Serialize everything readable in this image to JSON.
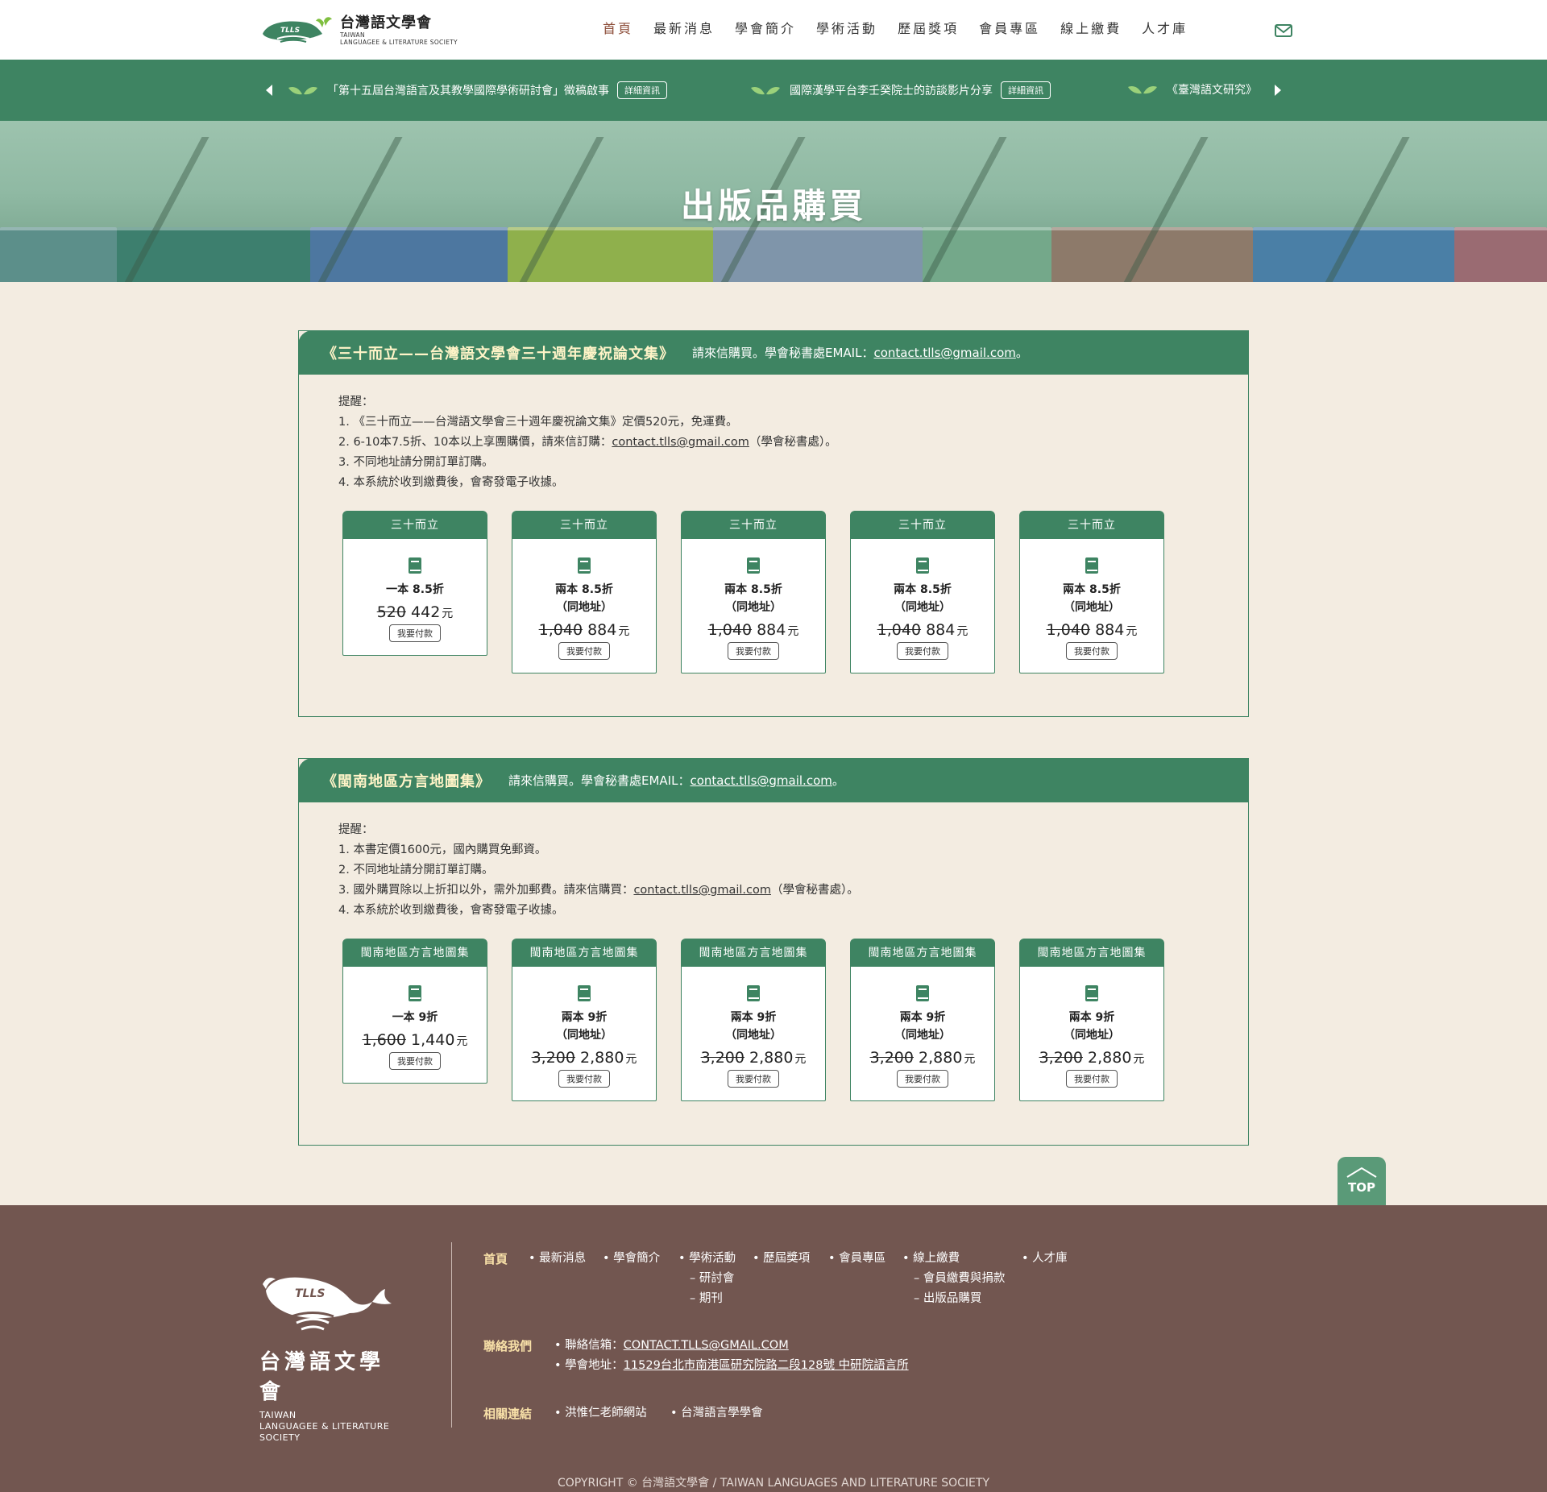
{
  "header": {
    "logo_zh": "台灣語文學會",
    "logo_en_1": "TAIWAN",
    "logo_en_2": "LANGUAGEE & LITERATURE SOCIETY",
    "logo_badge": "TLLS",
    "nav": [
      "首頁",
      "最新消息",
      "學會簡介",
      "學術活動",
      "歷屆獎項",
      "會員專區",
      "線上繳費",
      "人才庫"
    ],
    "active_nav": "首頁"
  },
  "ticker": {
    "items": [
      {
        "text": "「第十五屆台灣語言及其教學國際學術研討會」徵稿啟事",
        "button": "詳細資訊"
      },
      {
        "text": "國際漢學平台李壬癸院士的訪談影片分享",
        "button": "詳細資訊"
      },
      {
        "text": "《臺灣語文研究》"
      }
    ]
  },
  "hero": {
    "title": "出版品購買"
  },
  "sections": [
    {
      "title": "《三十而立——台灣語文學會三十週年慶祝論文集》",
      "note_prefix": "請來信購買。學會秘書處EMAIL：",
      "email": "contact.tlls@gmail.com",
      "note_suffix": "。",
      "notes": {
        "heading": "提醒：",
        "n1": "1. 《三十而立——台灣語文學會三十週年慶祝論文集》定價520元，免運費。",
        "n2_prefix": "2. 6-10本7.5折、10本以上享團購價，請來信訂購：",
        "n2_email": "contact.tlls@gmail.com",
        "n2_suffix": "（學會秘書處）。",
        "n3": "3. 不同地址請分開訂單訂購。",
        "n4": "4. 本系統於收到繳費後，會寄發電子收據。"
      },
      "cards": [
        {
          "head": "三十而立",
          "desc": "一本 8.5折",
          "sub": "",
          "original": "520",
          "price": "442",
          "unit": "元",
          "button": "我要付款"
        },
        {
          "head": "三十而立",
          "desc": "兩本 8.5折",
          "sub": "（同地址）",
          "original": "1,040",
          "price": "884",
          "unit": "元",
          "button": "我要付款"
        },
        {
          "head": "三十而立",
          "desc": "兩本 8.5折",
          "sub": "（同地址）",
          "original": "1,040",
          "price": "884",
          "unit": "元",
          "button": "我要付款"
        },
        {
          "head": "三十而立",
          "desc": "兩本 8.5折",
          "sub": "（同地址）",
          "original": "1,040",
          "price": "884",
          "unit": "元",
          "button": "我要付款"
        },
        {
          "head": "三十而立",
          "desc": "兩本 8.5折",
          "sub": "（同地址）",
          "original": "1,040",
          "price": "884",
          "unit": "元",
          "button": "我要付款"
        }
      ]
    },
    {
      "title": "《閩南地區方言地圖集》",
      "note_prefix": "請來信購買。學會秘書處EMAIL：",
      "email": "contact.tlls@gmail.com",
      "note_suffix": "。",
      "notes": {
        "heading": "提醒：",
        "n1": "1. 本書定價1600元，國內購買免郵資。",
        "n2": "2. 不同地址請分開訂單訂購。",
        "n3_prefix": "3. 國外購買除以上折扣以外，需外加郵費。請來信購買：",
        "n3_email": "contact.tlls@gmail.com",
        "n3_suffix": "（學會秘書處）。",
        "n4": "4. 本系統於收到繳費後，會寄發電子收據。"
      },
      "cards": [
        {
          "head": "閩南地區方言地圖集",
          "desc": "一本 9折",
          "sub": "",
          "original": "1,600",
          "price": "1,440",
          "unit": "元",
          "button": "我要付款"
        },
        {
          "head": "閩南地區方言地圖集",
          "desc": "兩本 9折",
          "sub": "（同地址）",
          "original": "3,200",
          "price": "2,880",
          "unit": "元",
          "button": "我要付款"
        },
        {
          "head": "閩南地區方言地圖集",
          "desc": "兩本 9折",
          "sub": "（同地址）",
          "original": "3,200",
          "price": "2,880",
          "unit": "元",
          "button": "我要付款"
        },
        {
          "head": "閩南地區方言地圖集",
          "desc": "兩本 9折",
          "sub": "（同地址）",
          "original": "3,200",
          "price": "2,880",
          "unit": "元",
          "button": "我要付款"
        },
        {
          "head": "閩南地區方言地圖集",
          "desc": "兩本 9折",
          "sub": "（同地址）",
          "original": "3,200",
          "price": "2,880",
          "unit": "元",
          "button": "我要付款"
        }
      ]
    }
  ],
  "top_button": "TOP",
  "footer": {
    "logo_badge": "TLLS",
    "logo_zh": "台灣語文學會",
    "logo_en_1": "TAIWAN",
    "logo_en_2": "LANGUAGEE & LITERATURE",
    "logo_en_3": "SOCIETY",
    "home": "首頁",
    "links": {
      "news": "• 最新消息",
      "about": "• 學會簡介",
      "activities": "• 學術活動",
      "activities_sub1": "– 研討會",
      "activities_sub2": "– 期刊",
      "awards": "• 歷屆獎項",
      "members": "• 會員專區",
      "payment": "• 線上繳費",
      "payment_sub1": "– 會員繳費與捐款",
      "payment_sub2": "– 出版品購買",
      "talent": "• 人才庫"
    },
    "contact_label": "聯絡我們",
    "contact_email_label": "• 聯絡信箱：",
    "contact_email": "CONTACT.TLLS@GMAIL.COM",
    "contact_address_label": "• 學會地址：",
    "contact_address": "11529台北市南港區研究院路二段128號 中研院語言所",
    "related_label": "相關連結",
    "related_1": "• 洪惟仁老師網站",
    "related_2": "• 台灣語言學學會",
    "copyright": "COPYRIGHT © 台灣語文學會 / TAIWAN LANGUAGES AND LITERATURE SOCIETY"
  },
  "colors": {
    "primary_green": "#3e8462",
    "title_yellow": "#fff4c8",
    "footer_brown": "#725650",
    "active_nav": "#8d4e3a",
    "page_bg": "#f3ece1"
  },
  "icons": [
    "mail-icon",
    "arrow-left-icon",
    "arrow-right-icon",
    "leaf-icon",
    "book-icon",
    "top-arrow-icon"
  ]
}
